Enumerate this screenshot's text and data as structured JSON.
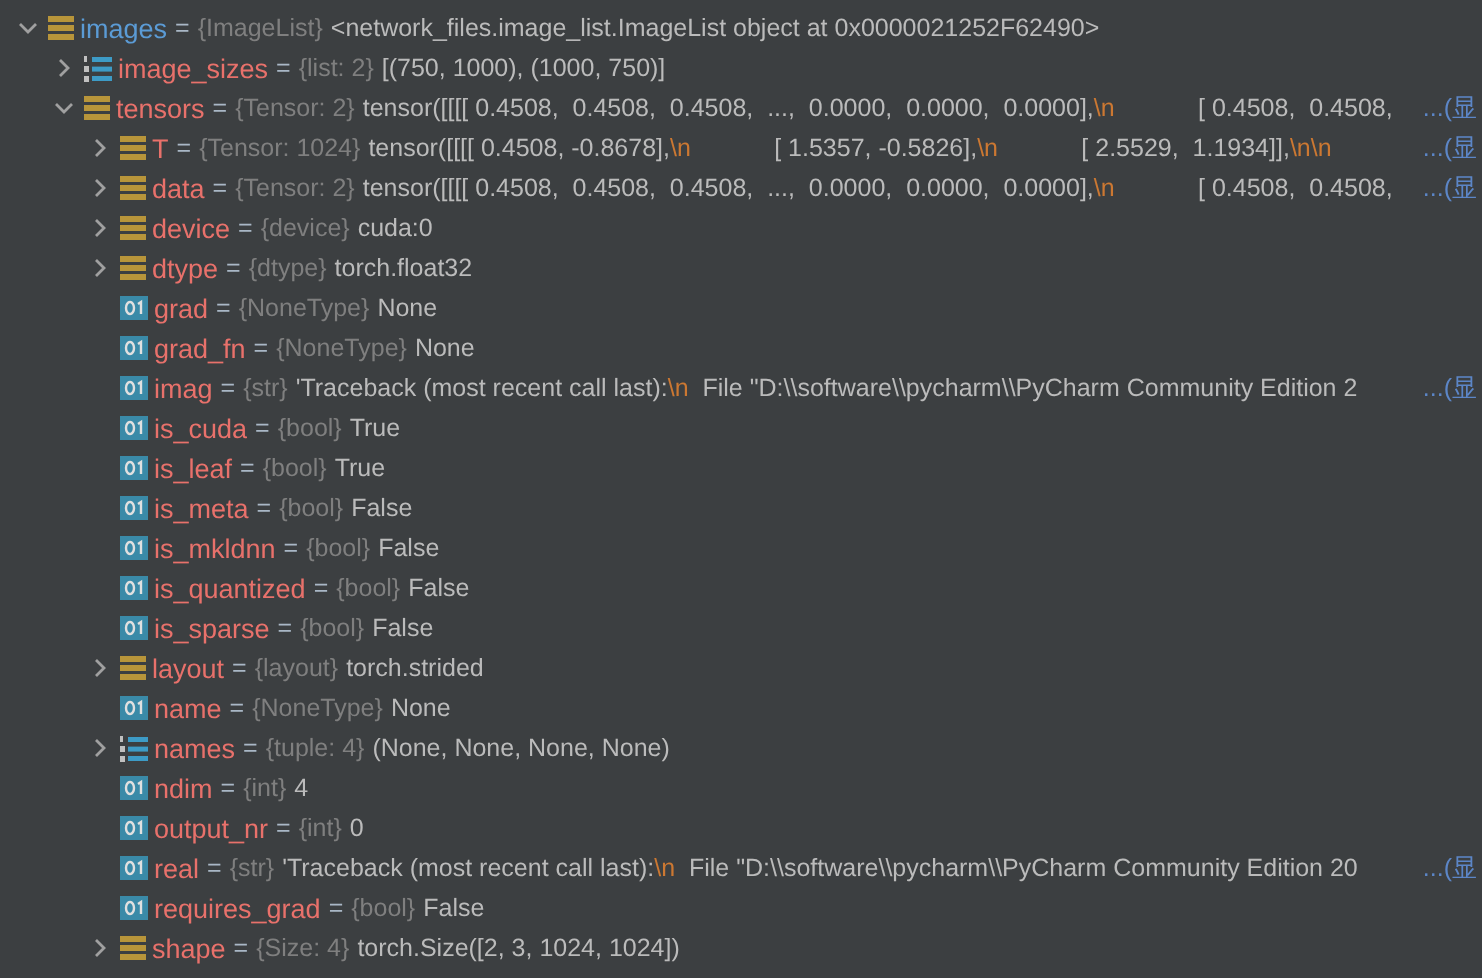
{
  "variables": [
    {
      "name": "images",
      "sep": "=",
      "type": "{ImageList}",
      "kind": "object",
      "expanded": true,
      "value": [
        {
          "kind": "text",
          "text": "<network_files.image_list.ImageList object at 0x0000021252F62490>"
        }
      ],
      "children": [
        {
          "name": "image_sizes",
          "sep": "=",
          "type": "{list: 2}",
          "kind": "list",
          "expanded": false,
          "value": [
            {
              "kind": "text",
              "text": "[(750, 1000), (1000, 750)]"
            }
          ]
        },
        {
          "name": "tensors",
          "sep": "=",
          "type": "{Tensor: 2}",
          "kind": "object",
          "expanded": true,
          "more": "...(显",
          "value": [
            {
              "kind": "text",
              "text": "tensor([[[[ 0.4508,  0.4508,  0.4508,  ...,  0.0000,  0.0000,  0.0000],"
            },
            {
              "kind": "escape",
              "text": "\\n"
            },
            {
              "kind": "text",
              "text": "            [ 0.4508,  0.4508,"
            }
          ],
          "children": [
            {
              "name": "T",
              "sep": "=",
              "type": "{Tensor: 1024}",
              "kind": "object",
              "expanded": false,
              "more": "...(显",
              "value": [
                {
                  "kind": "text",
                  "text": "tensor([[[[ 0.4508, -0.8678],"
                },
                {
                  "kind": "escape",
                  "text": "\\n"
                },
                {
                  "kind": "text",
                  "text": "            [ 1.5357, -0.5826],"
                },
                {
                  "kind": "escape",
                  "text": "\\n"
                },
                {
                  "kind": "text",
                  "text": "            [ 2.5529,  1.1934]],"
                },
                {
                  "kind": "escape",
                  "text": "\\n\\n"
                }
              ]
            },
            {
              "name": "data",
              "sep": "=",
              "type": "{Tensor: 2}",
              "kind": "object",
              "expanded": false,
              "more": "...(显",
              "value": [
                {
                  "kind": "text",
                  "text": "tensor([[[[ 0.4508,  0.4508,  0.4508,  ...,  0.0000,  0.0000,  0.0000],"
                },
                {
                  "kind": "escape",
                  "text": "\\n"
                },
                {
                  "kind": "text",
                  "text": "            [ 0.4508,  0.4508,"
                }
              ]
            },
            {
              "name": "device",
              "sep": "=",
              "type": "{device}",
              "kind": "object",
              "expanded": false,
              "value": [
                {
                  "kind": "text",
                  "text": "cuda:0"
                }
              ]
            },
            {
              "name": "dtype",
              "sep": "=",
              "type": "{dtype}",
              "kind": "object",
              "expanded": false,
              "value": [
                {
                  "kind": "text",
                  "text": "torch.float32"
                }
              ]
            },
            {
              "name": "grad",
              "sep": "=",
              "type": "{NoneType}",
              "kind": "primitive",
              "value": [
                {
                  "kind": "text",
                  "text": "None"
                }
              ]
            },
            {
              "name": "grad_fn",
              "sep": "=",
              "type": "{NoneType}",
              "kind": "primitive",
              "value": [
                {
                  "kind": "text",
                  "text": "None"
                }
              ]
            },
            {
              "name": "imag",
              "sep": "=",
              "type": "{str}",
              "kind": "primitive",
              "more": "...(显",
              "value": [
                {
                  "kind": "text",
                  "text": "'Traceback (most recent call last):"
                },
                {
                  "kind": "escape",
                  "text": "\\n"
                },
                {
                  "kind": "text",
                  "text": "  File \"D:\\\\software\\\\pycharm\\\\PyCharm Community Edition 2"
                }
              ]
            },
            {
              "name": "is_cuda",
              "sep": "=",
              "type": "{bool}",
              "kind": "primitive",
              "value": [
                {
                  "kind": "text",
                  "text": "True"
                }
              ]
            },
            {
              "name": "is_leaf",
              "sep": "=",
              "type": "{bool}",
              "kind": "primitive",
              "value": [
                {
                  "kind": "text",
                  "text": "True"
                }
              ]
            },
            {
              "name": "is_meta",
              "sep": "=",
              "type": "{bool}",
              "kind": "primitive",
              "value": [
                {
                  "kind": "text",
                  "text": "False"
                }
              ]
            },
            {
              "name": "is_mkldnn",
              "sep": "=",
              "type": "{bool}",
              "kind": "primitive",
              "value": [
                {
                  "kind": "text",
                  "text": "False"
                }
              ]
            },
            {
              "name": "is_quantized",
              "sep": "=",
              "type": "{bool}",
              "kind": "primitive",
              "value": [
                {
                  "kind": "text",
                  "text": "False"
                }
              ]
            },
            {
              "name": "is_sparse",
              "sep": "=",
              "type": "{bool}",
              "kind": "primitive",
              "value": [
                {
                  "kind": "text",
                  "text": "False"
                }
              ]
            },
            {
              "name": "layout",
              "sep": "=",
              "type": "{layout}",
              "kind": "object",
              "expanded": false,
              "value": [
                {
                  "kind": "text",
                  "text": "torch.strided"
                }
              ]
            },
            {
              "name": "name",
              "sep": "=",
              "type": "{NoneType}",
              "kind": "primitive",
              "value": [
                {
                  "kind": "text",
                  "text": "None"
                }
              ]
            },
            {
              "name": "names",
              "sep": "=",
              "type": "{tuple: 4}",
              "kind": "list",
              "expanded": false,
              "value": [
                {
                  "kind": "text",
                  "text": "(None, None, None, None)"
                }
              ]
            },
            {
              "name": "ndim",
              "sep": "=",
              "type": "{int}",
              "kind": "primitive",
              "value": [
                {
                  "kind": "text",
                  "text": "4"
                }
              ]
            },
            {
              "name": "output_nr",
              "sep": "=",
              "type": "{int}",
              "kind": "primitive",
              "value": [
                {
                  "kind": "text",
                  "text": "0"
                }
              ]
            },
            {
              "name": "real",
              "sep": "=",
              "type": "{str}",
              "kind": "primitive",
              "more": "...(显",
              "value": [
                {
                  "kind": "text",
                  "text": "'Traceback (most recent call last):"
                },
                {
                  "kind": "escape",
                  "text": "\\n"
                },
                {
                  "kind": "text",
                  "text": "  File \"D:\\\\software\\\\pycharm\\\\PyCharm Community Edition 20"
                }
              ]
            },
            {
              "name": "requires_grad",
              "sep": "=",
              "type": "{bool}",
              "kind": "primitive",
              "value": [
                {
                  "kind": "text",
                  "text": "False"
                }
              ]
            },
            {
              "name": "shape",
              "sep": "=",
              "type": "{Size: 4}",
              "kind": "object",
              "expanded": false,
              "value": [
                {
                  "kind": "text",
                  "text": "torch.Size([2, 3, 1024, 1024])"
                }
              ]
            }
          ]
        }
      ]
    }
  ]
}
